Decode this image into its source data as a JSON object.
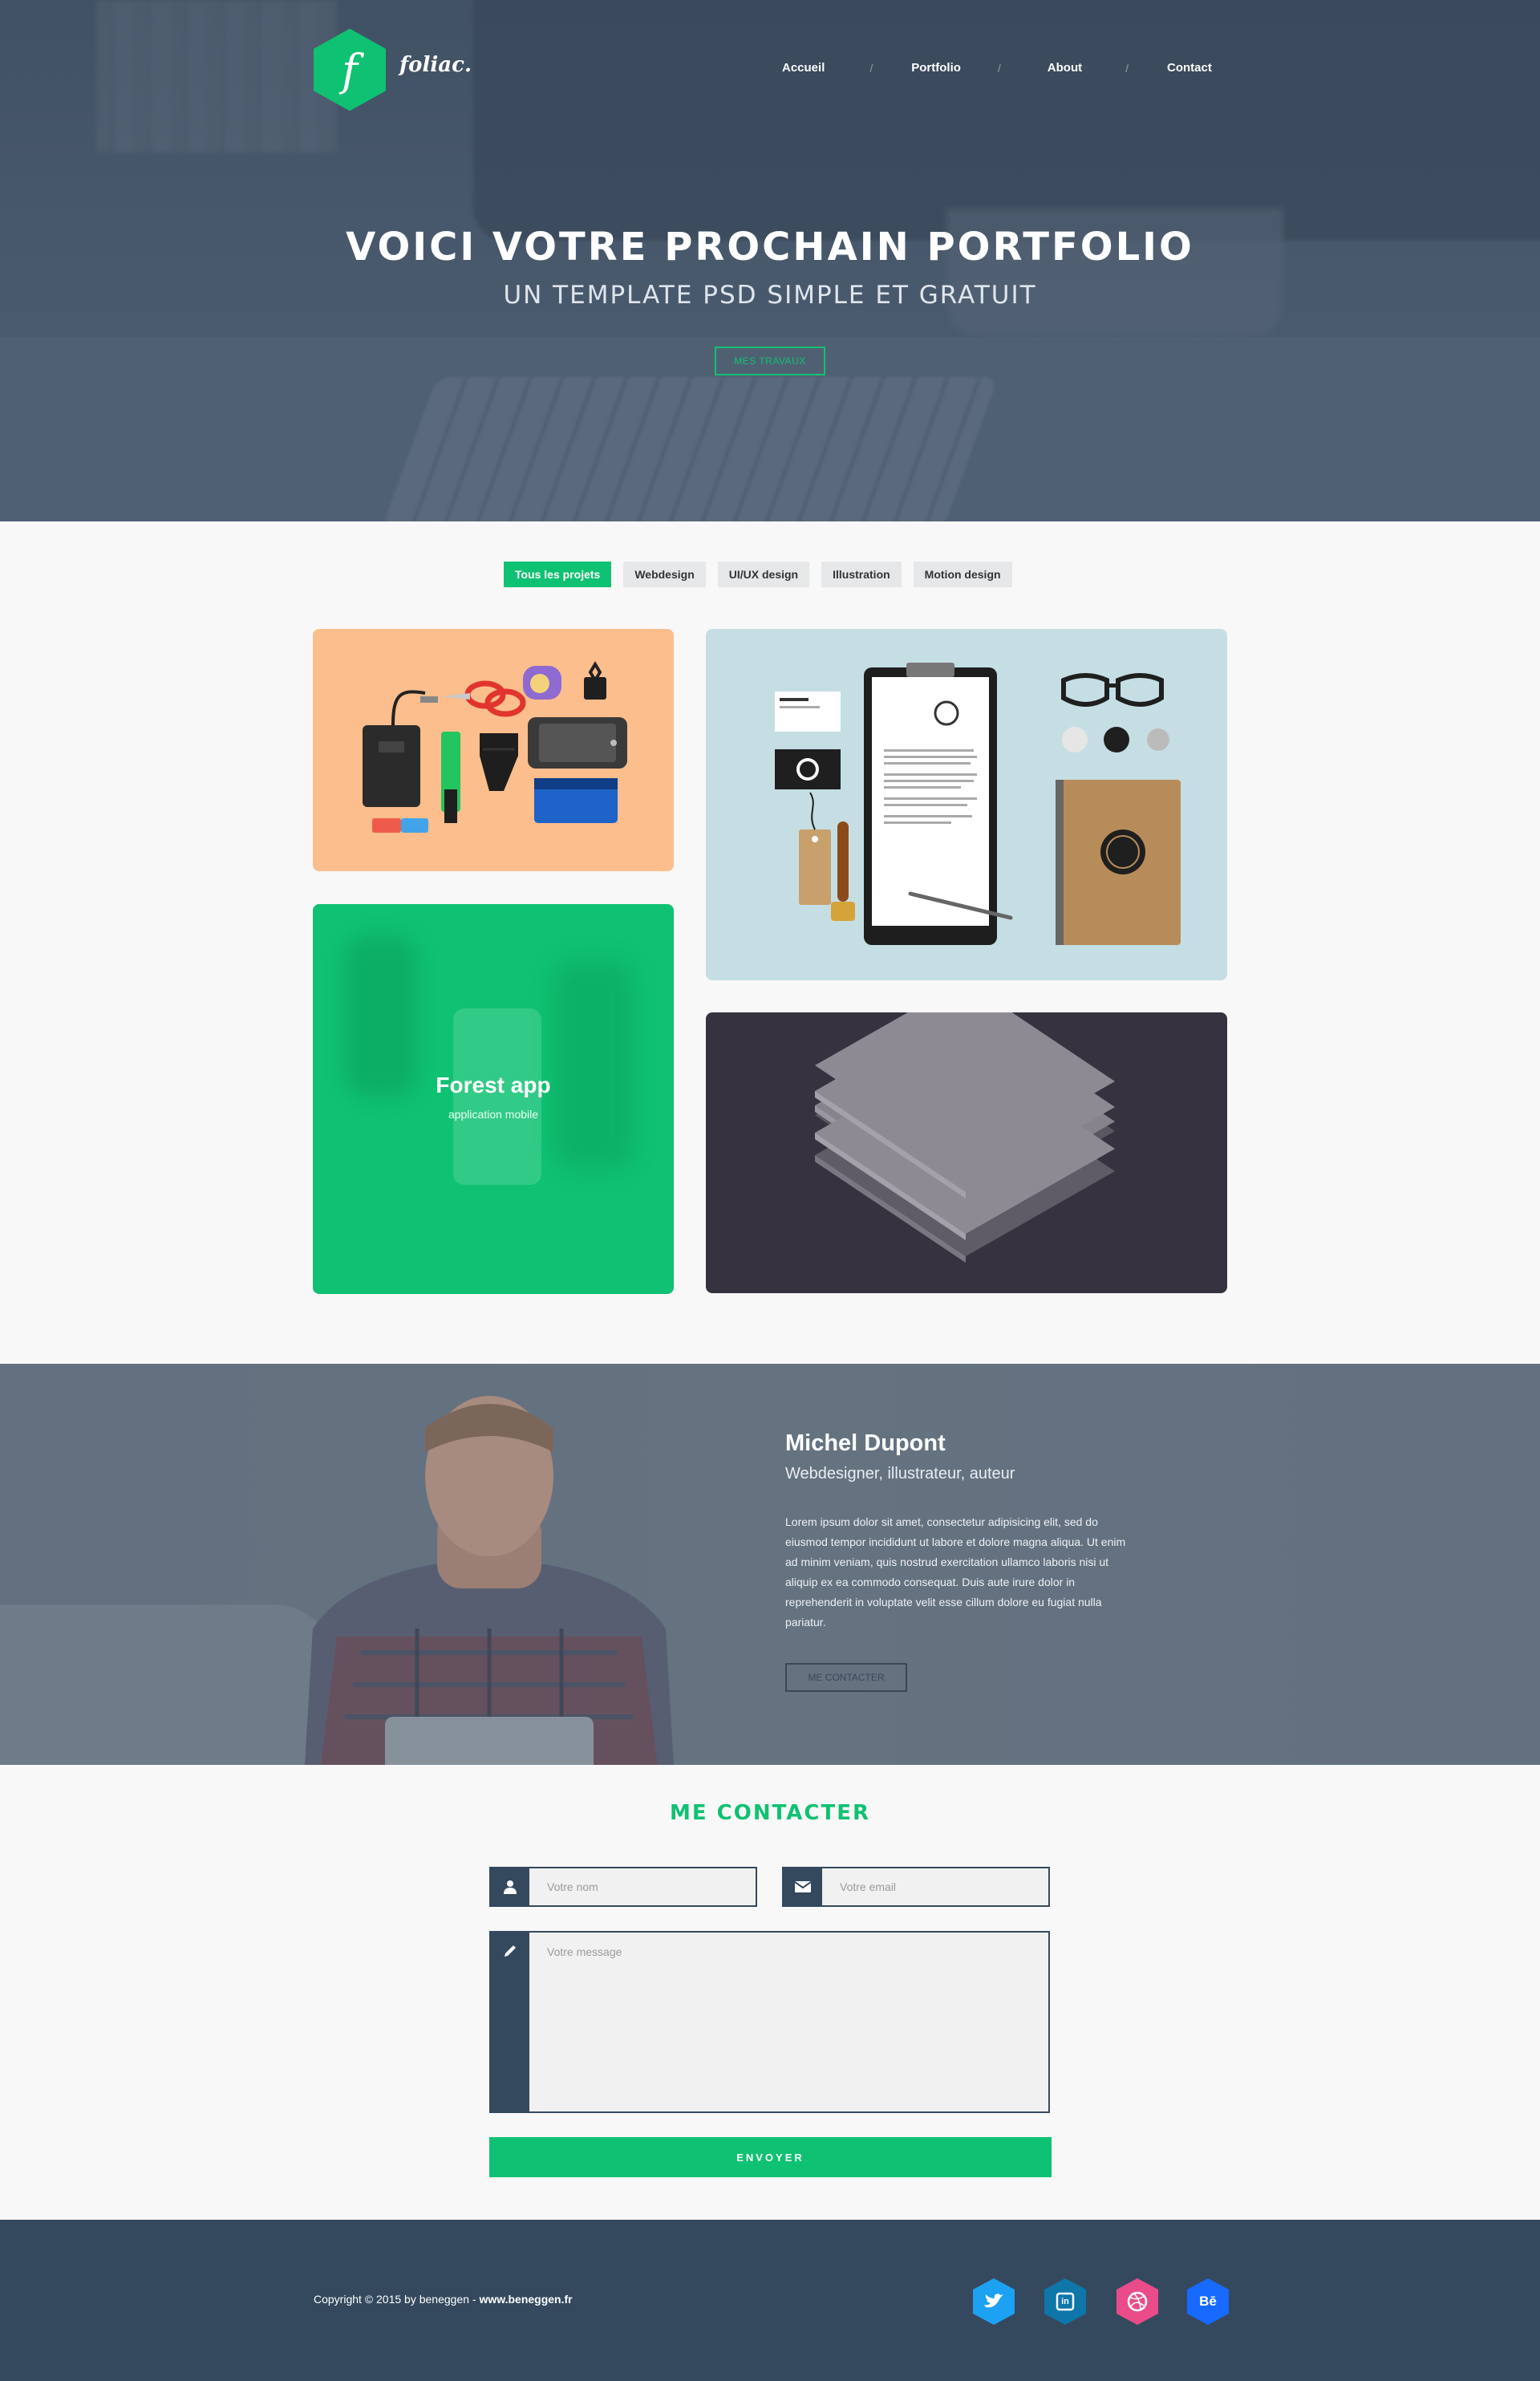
{
  "brand": {
    "logo_letter": "f",
    "wordmark": "foliac."
  },
  "nav": {
    "items": [
      "Accueil",
      "Portfolio",
      "About",
      "Contact"
    ],
    "separator": "/"
  },
  "hero": {
    "title": "VOICI VOTRE PROCHAIN PORTFOLIO",
    "subtitle": "UN TEMPLATE PSD SIMPLE ET GRATUIT",
    "cta": "MES TRAVAUX"
  },
  "filters": {
    "items": [
      "Tous les projets",
      "Webdesign",
      "UI/UX design",
      "Illustration",
      "Motion design"
    ],
    "active_index": 0
  },
  "portfolio": {
    "featured": {
      "title": "Forest app",
      "subtitle": "application mobile"
    }
  },
  "about": {
    "name": "Michel Dupont",
    "role": "Webdesigner, illustrateur, auteur",
    "bio": "Lorem ipsum dolor sit amet, consectetur adipisicing elit, sed do eiusmod tempor incididunt ut labore et dolore magna aliqua. Ut enim ad minim veniam, quis nostrud exercitation ullamco laboris nisi ut aliquip ex ea commodo consequat. Duis aute irure dolor in reprehenderit in voluptate velit esse cillum dolore eu fugiat nulla pariatur.",
    "cta": "ME CONTACTER"
  },
  "contact": {
    "title": "ME CONTACTER",
    "name_placeholder": "Votre nom",
    "email_placeholder": "Votre email",
    "message_placeholder": "Votre message",
    "submit": "ENVOYER"
  },
  "footer": {
    "copyright_prefix": "Copyright © 2015 by beneggen - ",
    "copyright_link": "www.beneggen.fr",
    "social": [
      {
        "name": "twitter-icon",
        "glyph": "",
        "color": "#1da1f2"
      },
      {
        "name": "linkedin-icon",
        "glyph": "in",
        "color": "#0e76a8"
      },
      {
        "name": "dribbble-icon",
        "glyph": "",
        "color": "#ea4c89"
      },
      {
        "name": "behance-icon",
        "glyph": "Bē",
        "color": "#1769ff"
      }
    ]
  },
  "colors": {
    "accent": "#0fc172",
    "dark": "#34495e",
    "tile_orange": "#fbbe8c",
    "tile_blue": "#c5dee4",
    "tile_dark": "#36323f"
  }
}
